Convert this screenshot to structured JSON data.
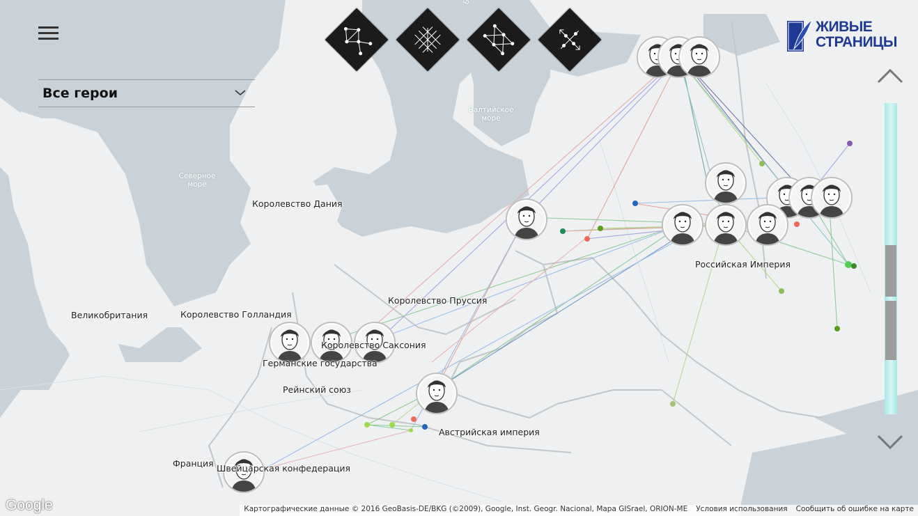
{
  "sidebar": {
    "hero_filter": {
      "selected": "Все герои"
    }
  },
  "brand": {
    "line1": "ЖИВЫЕ",
    "line2": "СТРАНИЦЫ",
    "color": "#1e3a93"
  },
  "tools": [
    {
      "name": "network-view-icon"
    },
    {
      "name": "grid-view-icon"
    },
    {
      "name": "links-view-icon"
    },
    {
      "name": "timeline-view-icon"
    }
  ],
  "map_labels": {
    "russia": "Российская Империя",
    "denmark": "Королевство Дания",
    "prussia": "Королевство Пруссия",
    "holland": "Королевство Голландия",
    "saxony": "Королевство Саксония",
    "german_states": "Германские государства",
    "rhine": "Рейнский союз",
    "austria": "Австрийская империя",
    "france": "Франция",
    "swiss": "Швейцарская конфедерация",
    "britain": "Великобритания",
    "baltic_sea": "Балтийское море",
    "north_sea": "Северное море",
    "bothnia": "Ботн"
  },
  "footer": {
    "google": "Google",
    "attribution": "Картографические данные © 2016 GeoBasis-DE/BKG (©2009), Google, Inst. Geogr. Nacional, Mapa GISrael, ORION-ME",
    "terms": "Условия использования",
    "report": "Сообщить об ошибке на карте"
  },
  "colors": {
    "water": "#c9d2d9",
    "land": "#eef0f1",
    "scroll_track": "#b7ecec",
    "link_colors": [
      "#8fb6e8",
      "#e39a8a",
      "#9c9be5",
      "#7ec48a",
      "#b5cf7f",
      "#5f5f9e",
      "#e8a9a9",
      "#7ac0b8"
    ]
  }
}
